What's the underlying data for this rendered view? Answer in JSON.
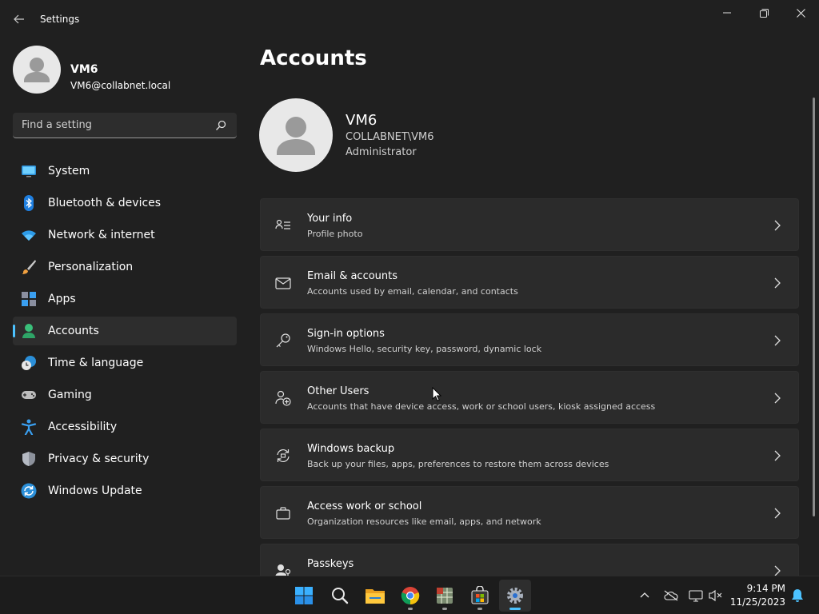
{
  "window": {
    "title": "Settings"
  },
  "user": {
    "name": "VM6",
    "email": "VM6@collabnet.local",
    "domain_account": "COLLABNET\\VM6",
    "role": "Administrator"
  },
  "search": {
    "placeholder": "Find a setting"
  },
  "sidebar": {
    "items": [
      {
        "label": "System",
        "icon": "system-icon"
      },
      {
        "label": "Bluetooth & devices",
        "icon": "bluetooth-icon"
      },
      {
        "label": "Network & internet",
        "icon": "wifi-icon"
      },
      {
        "label": "Personalization",
        "icon": "brush-icon"
      },
      {
        "label": "Apps",
        "icon": "apps-icon"
      },
      {
        "label": "Accounts",
        "icon": "accounts-icon",
        "selected": true
      },
      {
        "label": "Time & language",
        "icon": "clock-globe-icon"
      },
      {
        "label": "Gaming",
        "icon": "gamepad-icon"
      },
      {
        "label": "Accessibility",
        "icon": "accessibility-icon"
      },
      {
        "label": "Privacy & security",
        "icon": "shield-icon"
      },
      {
        "label": "Windows Update",
        "icon": "update-icon"
      }
    ]
  },
  "main": {
    "title": "Accounts",
    "cards": [
      {
        "title": "Your info",
        "subtitle": "Profile photo",
        "icon": "person-lines-icon"
      },
      {
        "title": "Email & accounts",
        "subtitle": "Accounts used by email, calendar, and contacts",
        "icon": "mail-icon"
      },
      {
        "title": "Sign-in options",
        "subtitle": "Windows Hello, security key, password, dynamic lock",
        "icon": "key-icon"
      },
      {
        "title": "Other Users",
        "subtitle": "Accounts that have device access, work or school users, kiosk assigned access",
        "icon": "person-add-icon"
      },
      {
        "title": "Windows backup",
        "subtitle": "Back up your files, apps, preferences to restore them across devices",
        "icon": "backup-icon"
      },
      {
        "title": "Access work or school",
        "subtitle": "Organization resources like email, apps, and network",
        "icon": "briefcase-icon"
      },
      {
        "title": "Passkeys",
        "subtitle": "",
        "icon": "passkey-icon"
      }
    ]
  },
  "taskbar": {
    "apps": [
      "start-icon",
      "search-icon",
      "file-explorer-icon",
      "chrome-icon",
      "spreadsheet-app-icon",
      "store-icon",
      "settings-icon"
    ],
    "time": "9:14 PM",
    "date": "11/25/2023"
  },
  "colors": {
    "background": "#202020",
    "card": "#2b2b2b",
    "accent": "#4cc2ff",
    "taskbar": "#1c1c1c"
  }
}
